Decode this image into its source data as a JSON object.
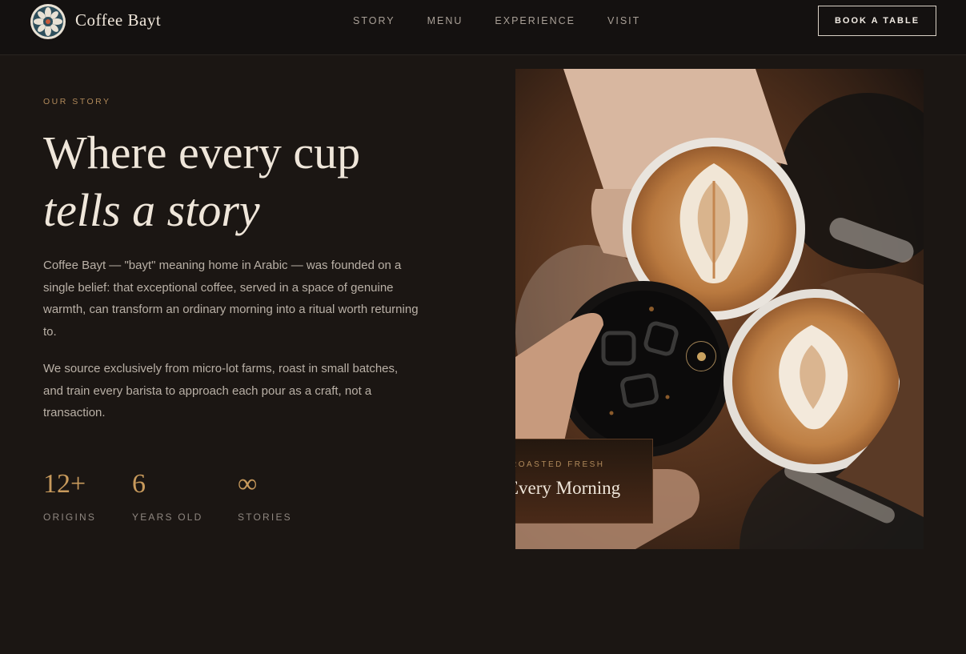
{
  "nav": {
    "brand": "Coffee Bayt",
    "links": [
      "STORY",
      "MENU",
      "EXPERIENCE",
      "VISIT"
    ],
    "cta": "BOOK A TABLE"
  },
  "story": {
    "eyebrow": "OUR STORY",
    "headline_line1": "Where every cup",
    "headline_line2": "tells a story",
    "paragraph1": "Coffee Bayt — \"bayt\" meaning home in Arabic — was founded on a single belief: that exceptional coffee, served in a space of genuine warmth, can transform an ordinary morning into a ritual worth returning to.",
    "paragraph2": "We source exclusively from micro-lot farms, roast in small batches, and train every barista to approach each pour as a craft, not a transaction.",
    "stats": [
      {
        "value": "12+",
        "label": "ORIGINS"
      },
      {
        "value": "6",
        "label": "YEARS OLD"
      },
      {
        "value": "∞",
        "label": "STORIES"
      }
    ]
  },
  "card": {
    "eyebrow": "ROASTED FRESH",
    "title": "Every Morning"
  },
  "colors": {
    "background": "#1b1613",
    "accent": "#c89a5c",
    "text_light": "#efe6da"
  }
}
